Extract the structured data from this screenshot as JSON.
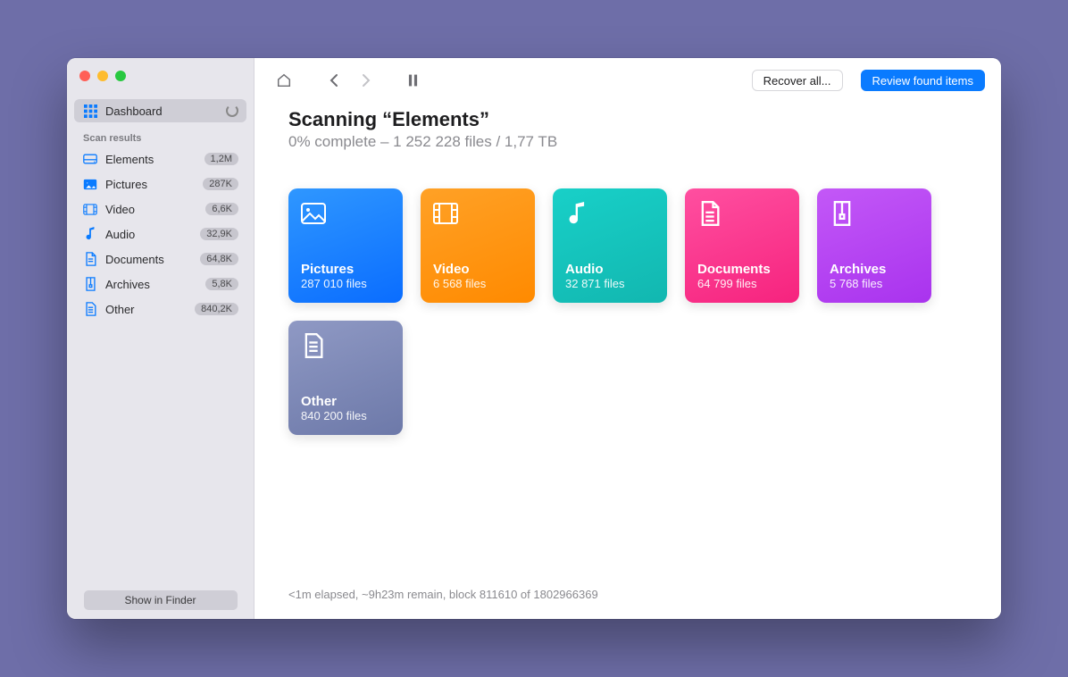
{
  "sidebar": {
    "dashboard_label": "Dashboard",
    "section_title": "Scan results",
    "items": [
      {
        "label": "Elements",
        "badge": "1,2M"
      },
      {
        "label": "Pictures",
        "badge": "287K"
      },
      {
        "label": "Video",
        "badge": "6,6K"
      },
      {
        "label": "Audio",
        "badge": "32,9K"
      },
      {
        "label": "Documents",
        "badge": "64,8K"
      },
      {
        "label": "Archives",
        "badge": "5,8K"
      },
      {
        "label": "Other",
        "badge": "840,2K"
      }
    ],
    "footer_button": "Show in Finder"
  },
  "toolbar": {
    "recover_label": "Recover all...",
    "review_label": "Review found items"
  },
  "header": {
    "title": "Scanning “Elements”",
    "subtitle": "0% complete – 1 252 228 files / 1,77 TB"
  },
  "tiles": [
    {
      "title": "Pictures",
      "sub": "287 010 files"
    },
    {
      "title": "Video",
      "sub": "6 568 files"
    },
    {
      "title": "Audio",
      "sub": "32 871 files"
    },
    {
      "title": "Documents",
      "sub": "64 799 files"
    },
    {
      "title": "Archives",
      "sub": "5 768 files"
    },
    {
      "title": "Other",
      "sub": "840 200 files"
    }
  ],
  "status": "<1m elapsed, ~9h23m remain, block 811610 of 1802966369"
}
